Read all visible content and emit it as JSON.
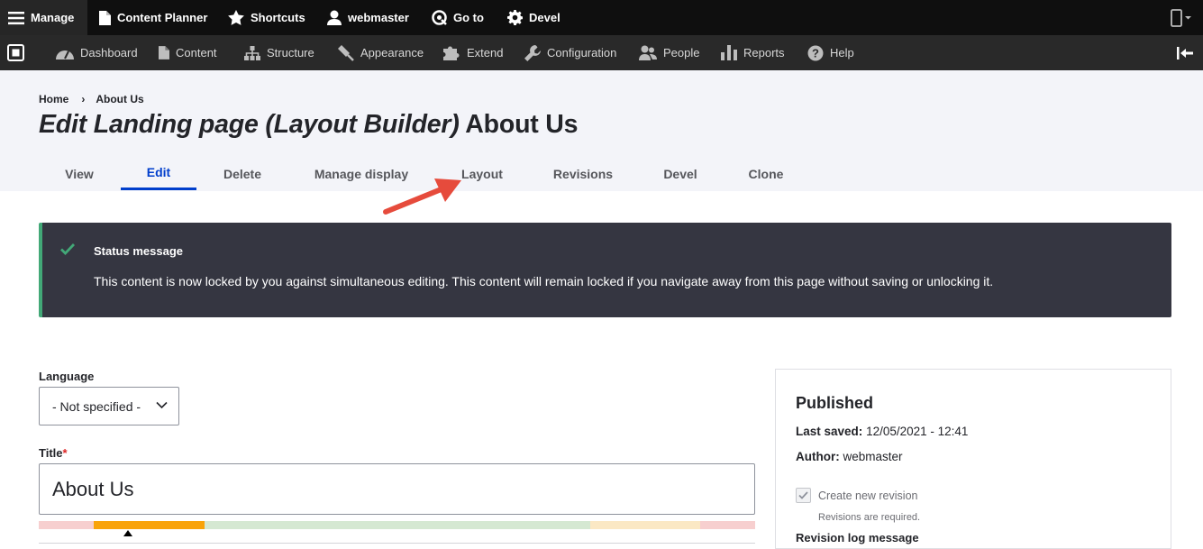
{
  "toolbar": {
    "manage_label": "Manage",
    "items": [
      {
        "label": "Content Planner",
        "icon": "document-icon"
      },
      {
        "label": "Shortcuts",
        "icon": "star-icon"
      },
      {
        "label": "webmaster",
        "icon": "user-icon"
      },
      {
        "label": "Go to",
        "icon": "goto-icon"
      },
      {
        "label": "Devel",
        "icon": "gear-icon"
      }
    ]
  },
  "admin_menu": {
    "items": [
      {
        "label": "Dashboard",
        "icon": "dashboard-icon"
      },
      {
        "label": "Content",
        "icon": "document-icon"
      },
      {
        "label": "Structure",
        "icon": "sitemap-icon"
      },
      {
        "label": "Appearance",
        "icon": "brush-icon"
      },
      {
        "label": "Extend",
        "icon": "puzzle-icon"
      },
      {
        "label": "Configuration",
        "icon": "wrench-icon"
      },
      {
        "label": "People",
        "icon": "people-icon"
      },
      {
        "label": "Reports",
        "icon": "bar-chart-icon"
      },
      {
        "label": "Help",
        "icon": "help-icon"
      }
    ]
  },
  "breadcrumb": {
    "home": "Home",
    "separator": "›",
    "current": "About Us"
  },
  "page_title": {
    "prefix": "Edit Landing page (Layout Builder)",
    "name": "About Us"
  },
  "tabs": [
    {
      "label": "View",
      "active": false
    },
    {
      "label": "Edit",
      "active": true
    },
    {
      "label": "Delete",
      "active": false
    },
    {
      "label": "Manage display",
      "active": false
    },
    {
      "label": "Layout",
      "active": false
    },
    {
      "label": "Revisions",
      "active": false
    },
    {
      "label": "Devel",
      "active": false
    },
    {
      "label": "Clone",
      "active": false
    }
  ],
  "status_message": {
    "title": "Status message",
    "text": "This content is now locked by you against simultaneous editing. This content will remain locked if you navigate away from this page without saving or unlocking it."
  },
  "form": {
    "language_label": "Language",
    "language_value": "- Not specified -",
    "title_label": "Title",
    "title_required": "*",
    "title_value": "About Us"
  },
  "meta": {
    "status": "Published",
    "last_saved_label": "Last saved:",
    "last_saved_value": "12/05/2021 - 12:41",
    "author_label": "Author:",
    "author_value": "webmaster",
    "revision_checkbox_label": "Create new revision",
    "revision_checkbox_checked": true,
    "revision_description": "Revisions are required.",
    "revision_log_label": "Revision log message"
  },
  "colors": {
    "accent": "#003ecc",
    "status_border": "#42a877",
    "status_bg": "#353641",
    "annotation_arrow": "#e64b3c"
  }
}
